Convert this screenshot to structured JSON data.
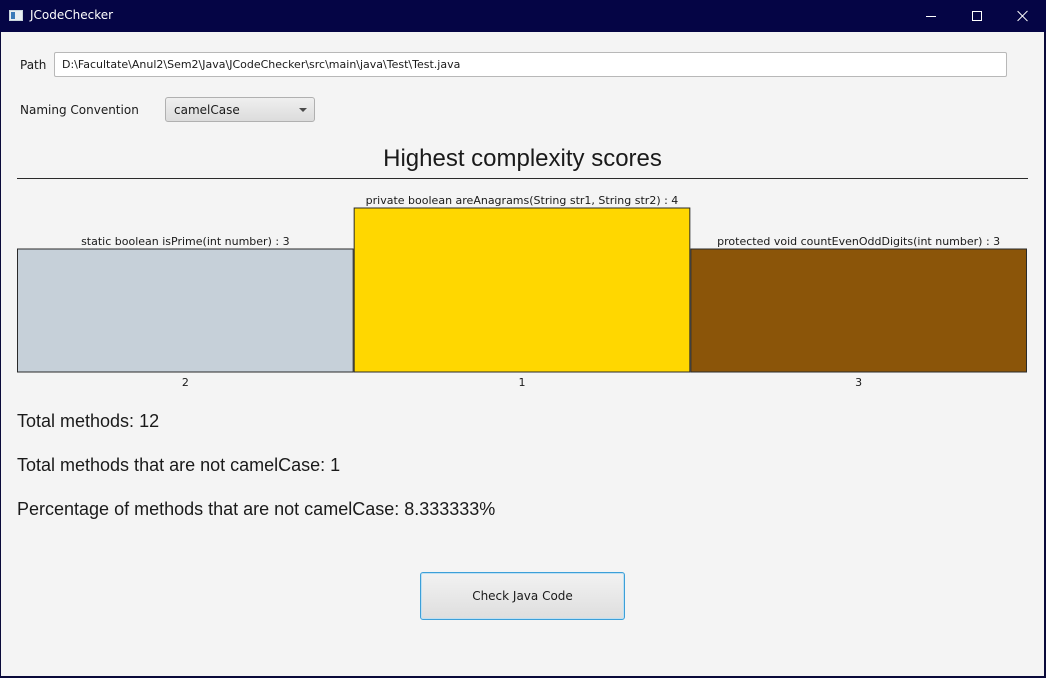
{
  "window": {
    "title": "JCodeChecker"
  },
  "form": {
    "path_label": "Path",
    "path_value": "D:\\Facultate\\Anul2\\Sem2\\Java\\JCodeChecker\\src\\main\\java\\Test\\Test.java",
    "naming_label": "Naming Convention",
    "naming_value": "camelCase"
  },
  "chart_data": {
    "type": "bar",
    "title": "Highest complexity scores",
    "categories": [
      "2",
      "1",
      "3"
    ],
    "labels": [
      "static boolean isPrime(int number) : 3",
      "private boolean areAnagrams(String str1, String str2) : 4",
      "protected void countEvenOddDigits(int number) : 3"
    ],
    "values": [
      3,
      4,
      3
    ],
    "colors": [
      "#c6d0d9",
      "#ffd700",
      "#8b5509"
    ],
    "ylim": [
      0,
      4
    ],
    "grid": false
  },
  "stats": {
    "total": "Total methods: 12",
    "not_convention": "Total methods that are not camelCase: 1",
    "percentage": "Percentage of methods that are not camelCase: 8.333333%"
  },
  "actions": {
    "check_label": "Check Java Code"
  }
}
